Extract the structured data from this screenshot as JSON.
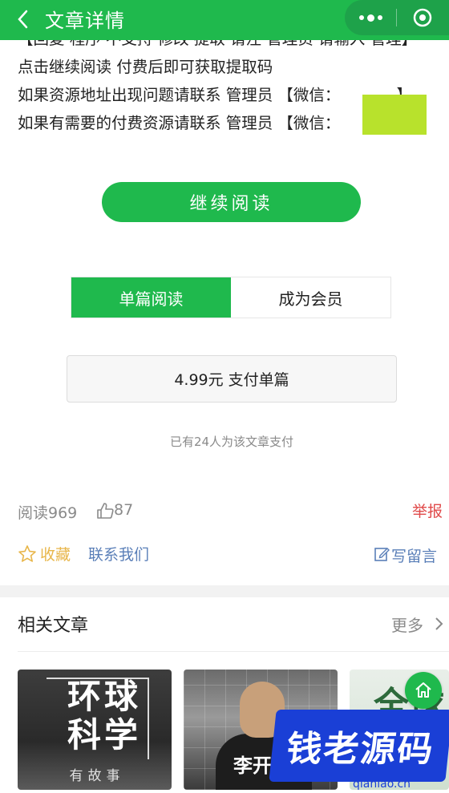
{
  "header": {
    "title": "文章详情"
  },
  "content": {
    "cut_line": "【回复 程序 不支持 修改 提取 请注 管理员 请输入 管理】",
    "line1": "点击继续阅读 付费后即可获取提取码",
    "line2": "如果资源地址出现问题请联系 管理员 【微信：",
    "line2_end": "】",
    "line3": "如果有需要的付费资源请联系 管理员 【微信：",
    "line3_end": "】"
  },
  "continue_button": {
    "label": "继续阅读"
  },
  "tabs": [
    {
      "label": "单篇阅读",
      "active": true
    },
    {
      "label": "成为会员",
      "active": false
    }
  ],
  "pay_button": {
    "label": "4.99元 支付单篇"
  },
  "paid_count": "已有24人为该文章支付",
  "stats": {
    "read": "阅读969",
    "likes": "87",
    "report": "举报"
  },
  "actions": {
    "favorite": "收藏",
    "contact": "联系我们",
    "comment": "写留言"
  },
  "related": {
    "title": "相关文章",
    "more": "更多",
    "cards": [
      {
        "title": "环球科学",
        "subtitle": "有故事"
      },
      {
        "title": "李开"
      },
      {
        "title": "全球"
      }
    ]
  },
  "watermark": {
    "brand": "钱老源码",
    "url": "qianlao.cn"
  },
  "colors": {
    "primary": "#1fb94d",
    "report": "#e04a4a",
    "link": "#5a7fb8",
    "favorite": "#e8b64a",
    "muted": "#8a8a8a"
  },
  "icons": [
    "back-icon",
    "more-icon",
    "circle-icon",
    "like-icon",
    "star-icon",
    "edit-icon",
    "chevron-right-icon",
    "home-icon"
  ]
}
